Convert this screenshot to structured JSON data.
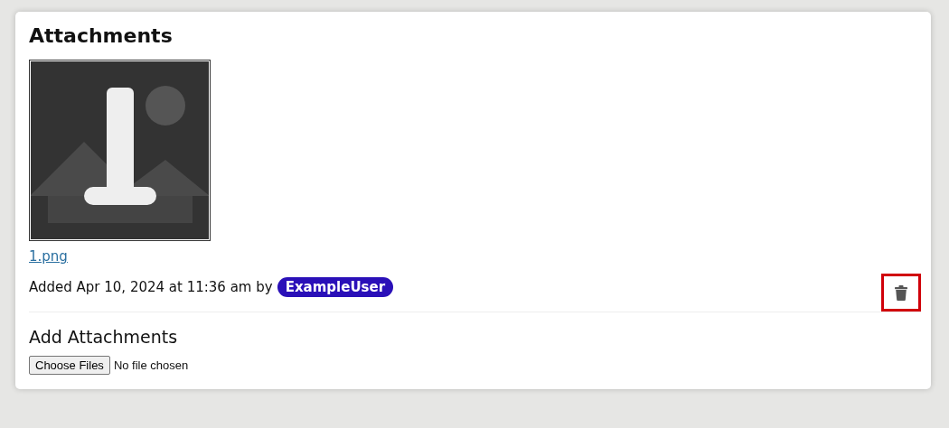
{
  "panel": {
    "title": "Attachments"
  },
  "attachments": [
    {
      "kind": "picture",
      "filename": "1.png",
      "added_text": "Added Apr 10, 2024 at 11:36 am by",
      "user": "ExampleUser",
      "delete_highlighted": true
    }
  ],
  "add_section": {
    "title": "Add Attachments",
    "choose_button": "Choose Files",
    "file_status": "No file chosen"
  }
}
